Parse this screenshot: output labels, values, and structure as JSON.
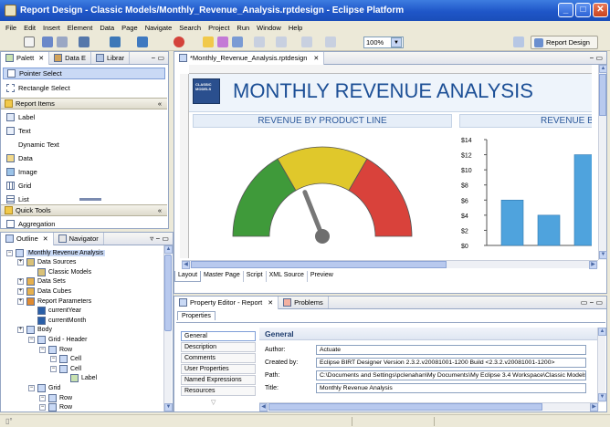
{
  "window": {
    "title": "Report Design - Classic Models/Monthly_Revenue_Analysis.rptdesign - Eclipse Platform"
  },
  "menu": [
    "File",
    "Edit",
    "Insert",
    "Element",
    "Data",
    "Page",
    "Navigate",
    "Search",
    "Project",
    "Run",
    "Window",
    "Help"
  ],
  "toolbar": {
    "zoom_value": "100%",
    "perspective_label": "Report Design"
  },
  "palette": {
    "tabs": [
      "Palett",
      "Data E",
      "Librar"
    ],
    "top_items": [
      "Pointer Select",
      "Rectangle Select"
    ],
    "report_items_header": "Report Items",
    "report_items": [
      "Label",
      "Text",
      "Dynamic Text",
      "Data",
      "Image",
      "Grid",
      "List"
    ],
    "quick_tools_header": "Quick Tools",
    "quick_tools": [
      "Aggregation"
    ]
  },
  "outline": {
    "tabs": [
      "Outline",
      "Navigator"
    ],
    "nodes": [
      {
        "label": "Monthly Revenue Analysis",
        "level": 0
      },
      {
        "label": "Data Sources",
        "level": 1
      },
      {
        "label": "Classic Models",
        "level": 2
      },
      {
        "label": "Data Sets",
        "level": 1
      },
      {
        "label": "Data Cubes",
        "level": 1
      },
      {
        "label": "Report Parameters",
        "level": 1
      },
      {
        "label": "currentYear",
        "level": 2
      },
      {
        "label": "currentMonth",
        "level": 2
      },
      {
        "label": "Body",
        "level": 1
      },
      {
        "label": "Grid - Header",
        "level": 2
      },
      {
        "label": "Row",
        "level": 3
      },
      {
        "label": "Cell",
        "level": 4
      },
      {
        "label": "Cell",
        "level": 4
      },
      {
        "label": "Label",
        "level": 5
      },
      {
        "label": "Grid",
        "level": 2
      },
      {
        "label": "Row",
        "level": 3
      },
      {
        "label": "Row",
        "level": 3
      }
    ]
  },
  "editor": {
    "tab_label": "*Monthly_Revenue_Analysis.rptdesign",
    "logo_text": "CLASSIC MODELS",
    "report_title": "MONTHLY REVENUE ANALYSIS",
    "section_left": "REVENUE BY PRODUCT LINE",
    "section_right": "REVENUE BY I",
    "bottom_tabs": [
      "Layout",
      "Master Page",
      "Script",
      "XML Source",
      "Preview"
    ],
    "bar_chart": {
      "type": "bar",
      "y_ticks": [
        "$14",
        "$12",
        "$10",
        "$8",
        "$6",
        "$4",
        "$2",
        "$0"
      ],
      "ylim": [
        0,
        14
      ],
      "values": [
        6,
        4,
        12
      ],
      "bar_color": "#4fa3dd"
    },
    "gauge": {
      "colors": [
        "#3f9a3a",
        "#e0c82b",
        "#d9423b"
      ],
      "needle_value": 0.38
    }
  },
  "property_editor": {
    "tabs": [
      "Property Editor - Report",
      "Problems"
    ],
    "sub_tab": "Properties",
    "side_items": [
      "General",
      "Description",
      "Comments",
      "User Properties",
      "Named Expressions",
      "Resources"
    ],
    "section_title": "General",
    "fields": [
      {
        "label": "Author:",
        "value": "Actuate"
      },
      {
        "label": "Created by:",
        "value": "Eclipse BIRT Designer Version 2.3.2.v20081001-1200 Build <2.3.2.v20081001-1200>"
      },
      {
        "label": "Path:",
        "value": "C:\\Documents and Settings\\pclenahan\\My Documents\\My Eclipse 3.4 Workspace\\Classic Models\\M"
      },
      {
        "label": "Title:",
        "value": "Monthly Revenue Analysis"
      }
    ]
  }
}
